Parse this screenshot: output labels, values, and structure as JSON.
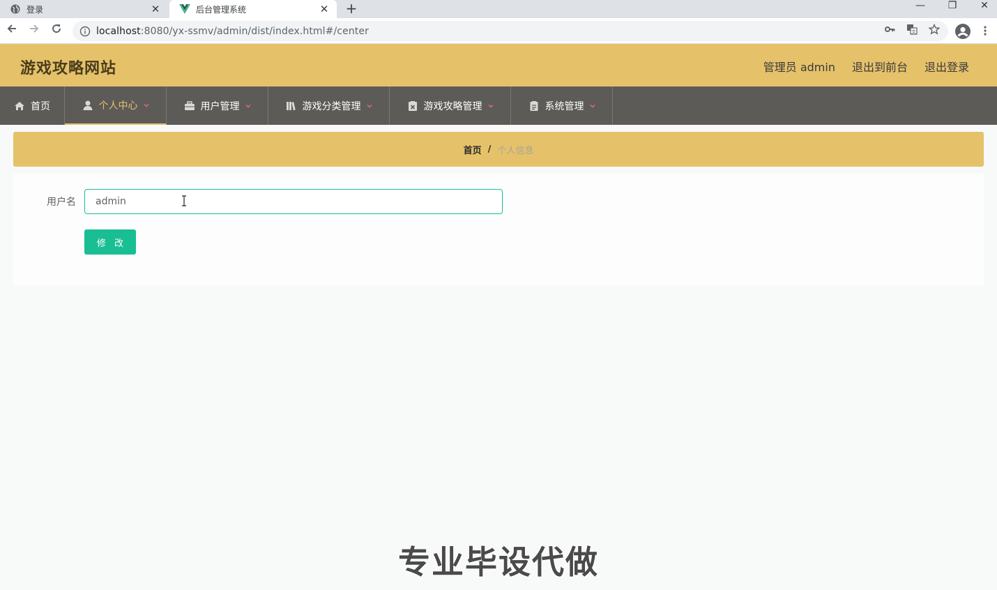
{
  "browser": {
    "tabs": [
      {
        "title": "登录",
        "icon": "globe-icon",
        "active": false
      },
      {
        "title": "后台管理系统",
        "icon": "vue-logo-icon",
        "active": true
      }
    ],
    "close_glyph": "✕",
    "new_tab_glyph": "+",
    "window_controls": {
      "minimize": "—",
      "restore": "❐",
      "close": "✕"
    },
    "url_host": "localhost",
    "url_path": ":8080/yx-ssmv/admin/dist/index.html#/center"
  },
  "header": {
    "site_title": "游戏攻略网站",
    "user_label": "管理员 admin",
    "to_front_label": "退出到前台",
    "logout_label": "退出登录"
  },
  "menu": {
    "items": [
      {
        "label": "首页",
        "icon": "home-icon"
      },
      {
        "label": "个人中心",
        "icon": "user-icon"
      },
      {
        "label": "用户管理",
        "icon": "briefcase-icon"
      },
      {
        "label": "游戏分类管理",
        "icon": "library-icon"
      },
      {
        "label": "游戏攻略管理",
        "icon": "clipboard-x-icon"
      },
      {
        "label": "系统管理",
        "icon": "document-icon"
      }
    ],
    "active_index": 1
  },
  "breadcrumb": {
    "home": "首页",
    "separator": "/",
    "current": "个人信息"
  },
  "form": {
    "username_label": "用户名",
    "username_value": "admin",
    "submit_label": "修 改"
  },
  "watermark": "专业毕设代做",
  "colors": {
    "header_bg": "#e5c26a",
    "menu_bg": "#5d5b58",
    "accent_green": "#19be93",
    "caret_red": "#e96a7b"
  }
}
